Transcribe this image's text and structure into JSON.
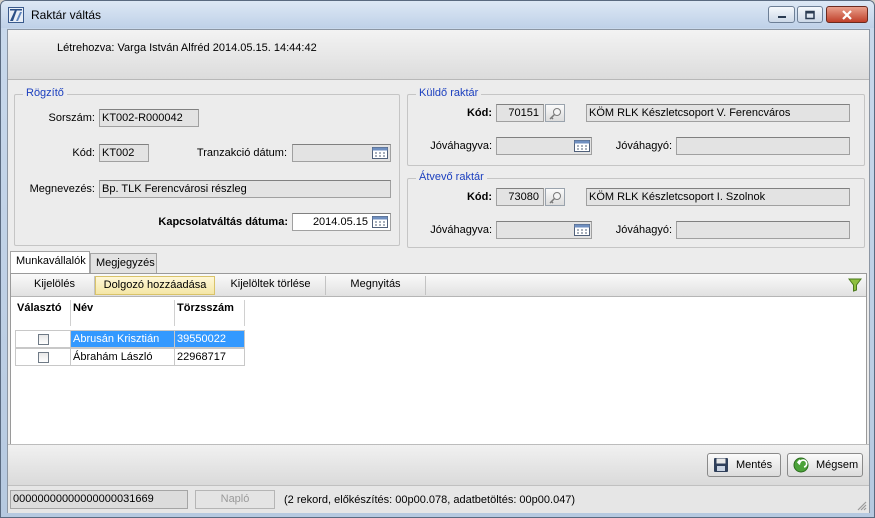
{
  "window": {
    "title": "Raktár váltás"
  },
  "header": {
    "created_text": "Létrehozva: Varga István Alfréd 2014.05.15. 14:44:42"
  },
  "rogzito": {
    "title": "Rögzítő",
    "sorszam_label": "Sorszám:",
    "sorszam_value": "KT002-R000042",
    "kod_label": "Kód:",
    "kod_value": "KT002",
    "tranzakcio_label": "Tranzakció dátum:",
    "tranzakcio_value": "",
    "megnevezes_label": "Megnevezés:",
    "megnevezes_value": "Bp. TLK Ferencvárosi részleg",
    "kapcsolat_label": "Kapcsolatváltás dátuma:",
    "kapcsolat_value": "2014.05.15"
  },
  "kuldo": {
    "title": "Küldő raktár",
    "kod_label": "Kód:",
    "kod_value": "70151",
    "name_value": "KÖM RLK Készletcsoport V. Ferencváros",
    "jovahagyva_label": "Jóváhagyva:",
    "jovahagyva_value": "",
    "jovahagyo_label": "Jóváhagyó:",
    "jovahagyo_value": ""
  },
  "atvevo": {
    "title": "Átvevő raktár",
    "kod_label": "Kód:",
    "kod_value": "73080",
    "name_value": "KÖM RLK Készletcsoport I. Szolnok",
    "jovahagyva_label": "Jóváhagyva:",
    "jovahagyva_value": "",
    "jovahagyo_label": "Jóváhagyó:",
    "jovahagyo_value": ""
  },
  "tabs": [
    {
      "label": "Munkavállalók",
      "active": true
    },
    {
      "label": "Megjegyzés",
      "active": false
    }
  ],
  "toolbar": {
    "kijeloles": "Kijelölés",
    "dolgozo": "Dolgozó hozzáadása",
    "torles": "Kijelöltek törlése",
    "megnyitas": "Megnyitás"
  },
  "table": {
    "headers": [
      "Választó",
      "Név",
      "Törzsszám"
    ],
    "rows": [
      {
        "selected": true,
        "checked": false,
        "nev": "Abrusán Krisztián",
        "torzsszam": "39550022"
      },
      {
        "selected": false,
        "checked": false,
        "nev": "Ábrahám László",
        "torzsszam": "22968717"
      }
    ]
  },
  "actions": {
    "save": "Mentés",
    "cancel": "Mégsem"
  },
  "status": {
    "id_value": "00000000000000000031669",
    "naplo": "Napló",
    "info": "(2 rekord, előkészítés: 00p00.078, adatbetöltés: 00p00.047)"
  },
  "colors": {
    "group_title": "#1b3fbf",
    "selection": "#3399ff"
  }
}
